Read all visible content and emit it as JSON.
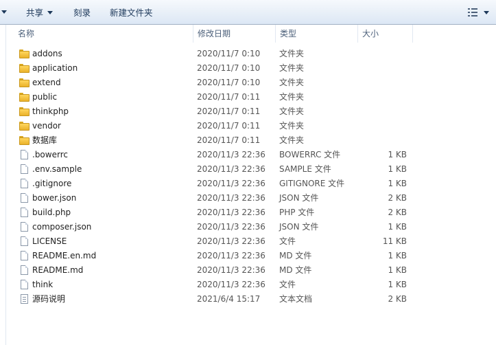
{
  "toolbar": {
    "share_label": "共享",
    "burn_label": "刻录",
    "new_folder_label": "新建文件夹",
    "view_icon": "view-options-icon"
  },
  "columns": {
    "name": "名称",
    "date": "修改日期",
    "type": "类型",
    "size": "大小"
  },
  "files": [
    {
      "name": "addons",
      "date": "2020/11/7 0:10",
      "type": "文件夹",
      "size": "",
      "icon": "folder"
    },
    {
      "name": "application",
      "date": "2020/11/7 0:10",
      "type": "文件夹",
      "size": "",
      "icon": "folder"
    },
    {
      "name": "extend",
      "date": "2020/11/7 0:10",
      "type": "文件夹",
      "size": "",
      "icon": "folder"
    },
    {
      "name": "public",
      "date": "2020/11/7 0:11",
      "type": "文件夹",
      "size": "",
      "icon": "folder"
    },
    {
      "name": "thinkphp",
      "date": "2020/11/7 0:11",
      "type": "文件夹",
      "size": "",
      "icon": "folder"
    },
    {
      "name": "vendor",
      "date": "2020/11/7 0:11",
      "type": "文件夹",
      "size": "",
      "icon": "folder"
    },
    {
      "name": "数据库",
      "date": "2020/11/7 0:11",
      "type": "文件夹",
      "size": "",
      "icon": "folder"
    },
    {
      "name": ".bowerrc",
      "date": "2020/11/3 22:36",
      "type": "BOWERRC 文件",
      "size": "1 KB",
      "icon": "file"
    },
    {
      "name": ".env.sample",
      "date": "2020/11/3 22:36",
      "type": "SAMPLE 文件",
      "size": "1 KB",
      "icon": "file"
    },
    {
      "name": ".gitignore",
      "date": "2020/11/3 22:36",
      "type": "GITIGNORE 文件",
      "size": "1 KB",
      "icon": "file"
    },
    {
      "name": "bower.json",
      "date": "2020/11/3 22:36",
      "type": "JSON 文件",
      "size": "2 KB",
      "icon": "file"
    },
    {
      "name": "build.php",
      "date": "2020/11/3 22:36",
      "type": "PHP 文件",
      "size": "2 KB",
      "icon": "file"
    },
    {
      "name": "composer.json",
      "date": "2020/11/3 22:36",
      "type": "JSON 文件",
      "size": "1 KB",
      "icon": "file"
    },
    {
      "name": "LICENSE",
      "date": "2020/11/3 22:36",
      "type": "文件",
      "size": "11 KB",
      "icon": "file"
    },
    {
      "name": "README.en.md",
      "date": "2020/11/3 22:36",
      "type": "MD 文件",
      "size": "1 KB",
      "icon": "file"
    },
    {
      "name": "README.md",
      "date": "2020/11/3 22:36",
      "type": "MD 文件",
      "size": "1 KB",
      "icon": "file"
    },
    {
      "name": "think",
      "date": "2020/11/3 22:36",
      "type": "文件",
      "size": "1 KB",
      "icon": "file"
    },
    {
      "name": "源码说明",
      "date": "2021/6/4 15:17",
      "type": "文本文档",
      "size": "2 KB",
      "icon": "text-document"
    }
  ]
}
